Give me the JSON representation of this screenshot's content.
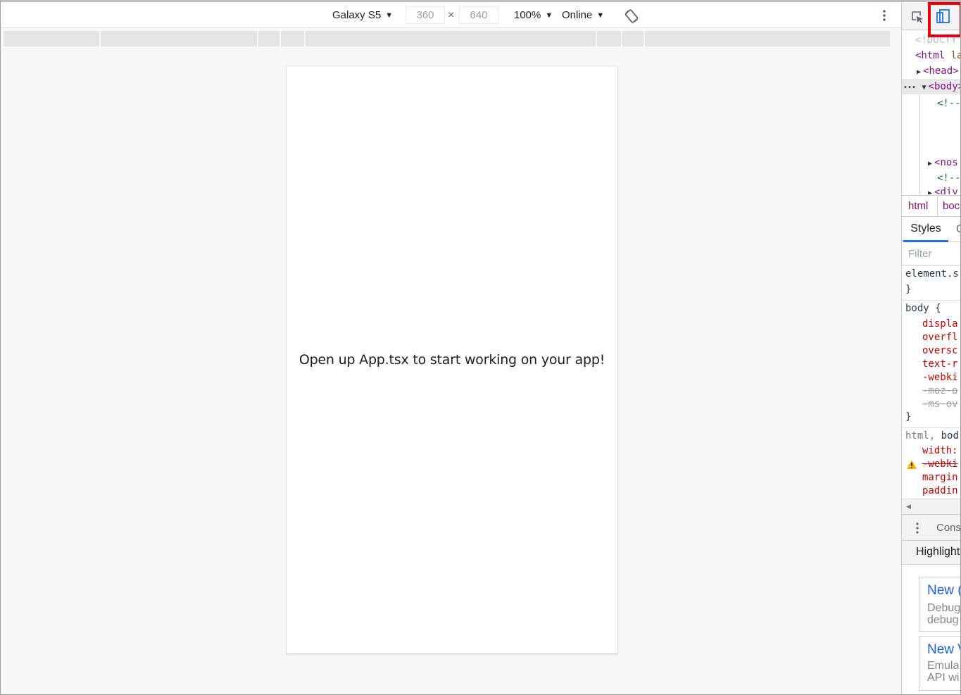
{
  "device_toolbar": {
    "device": "Galaxy S5",
    "width": "360",
    "height": "640",
    "times": "×",
    "zoom": "100%",
    "throttle": "Online"
  },
  "page": {
    "text": "Open up App.tsx to start working on your app!"
  },
  "devtools": {
    "elements": {
      "doctype": "<!DOCTY",
      "html_open": "<html",
      "html_attr": "la",
      "head": "<head>",
      "body_dots": "•••",
      "body": "<body>",
      "comment1": "<!--",
      "noscript": "<nos",
      "comment2": "<!--",
      "div": "<div"
    },
    "breadcrumb": [
      "html",
      "boc"
    ],
    "tabs": {
      "styles": "Styles",
      "computed": "C"
    },
    "filter_placeholder": "Filter",
    "styles": {
      "element_style": "element.s",
      "close_brace": "}",
      "body_selector": "body {",
      "body_props": [
        "displa",
        "overfl",
        "oversc",
        "text-r",
        "-webki",
        "-moz-o",
        "-ms-ov"
      ],
      "html_body_selector_1": "html,",
      "html_body_selector_2": "bod",
      "html_body_props": [
        "width:",
        "-webki",
        "margin",
        "paddin"
      ]
    },
    "drawer": {
      "console_tab": "Cons",
      "highlights": "Highlight"
    },
    "whats_new": [
      {
        "title": "New (",
        "line1": "Debug",
        "line2": "debug"
      },
      {
        "title": "New V",
        "line1": "Emula",
        "line2": "API wi"
      }
    ],
    "icons": {
      "inspect": "inspect-element-icon",
      "device_toggle": "device-toolbar-icon",
      "rotate": "rotate-icon",
      "more": "more-vert-icon",
      "warning": "warning-icon"
    },
    "colors": {
      "highlight_box": "#e8000b",
      "accent": "#1a73e8",
      "tag": "#881280",
      "css_prop": "#c80000"
    }
  }
}
